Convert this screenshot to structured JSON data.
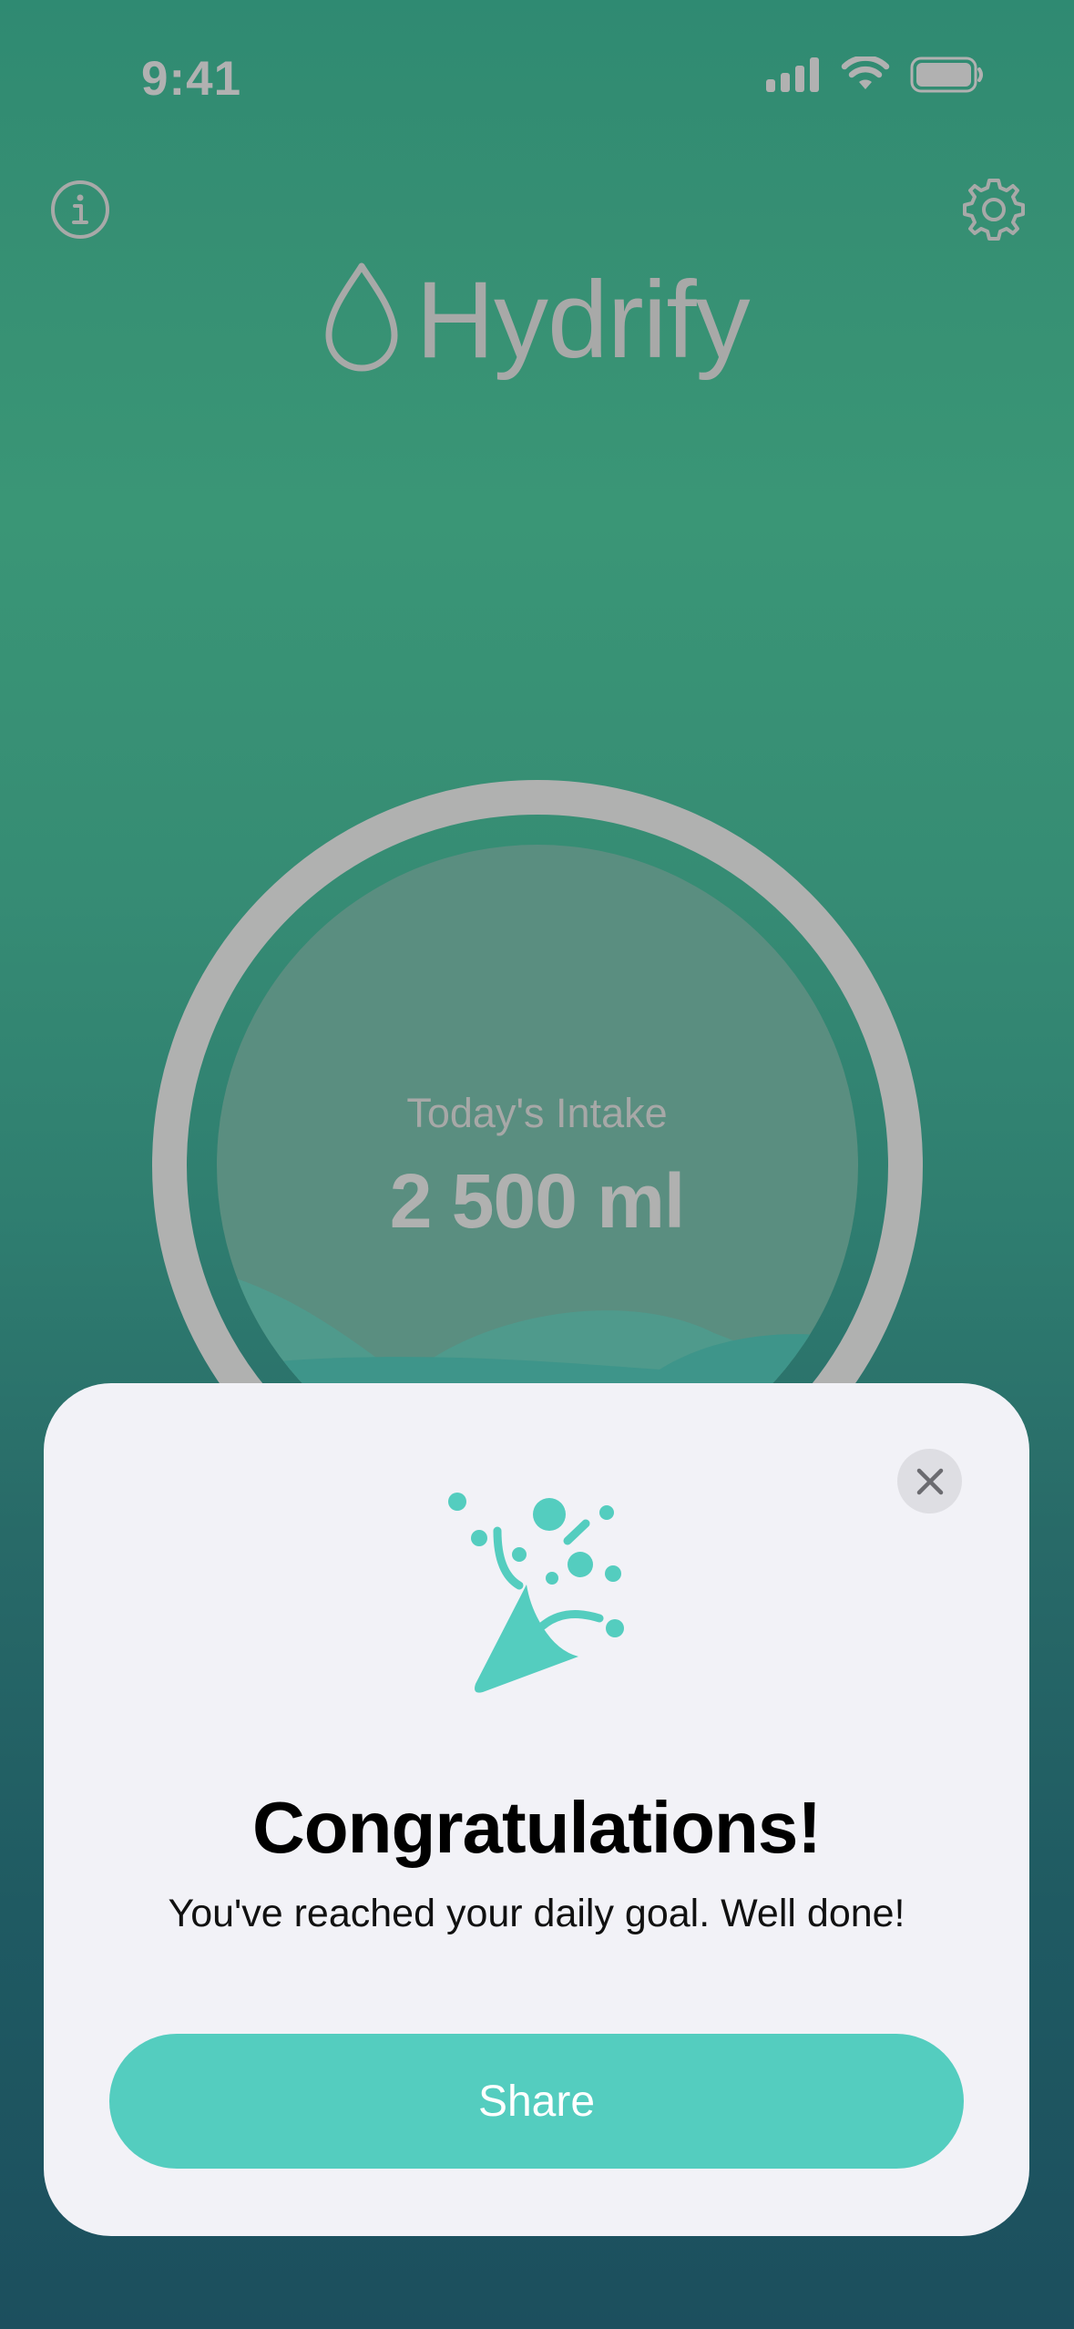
{
  "status_bar": {
    "time": "9:41",
    "icons": [
      "cellular-signal-icon",
      "wifi-icon",
      "battery-icon"
    ]
  },
  "header": {
    "info_icon": "info-icon",
    "settings_icon": "gear-icon",
    "app_name": "Hydrify",
    "logo_icon": "water-drop-icon"
  },
  "intake": {
    "label": "Today's Intake",
    "value": "2 500 ml"
  },
  "goal_sheet": {
    "close_icon": "close-icon",
    "illustration_icon": "party-popper-icon",
    "title": "Congratulations!",
    "message": "You've reached your daily goal. Well done!",
    "share_label": "Share"
  },
  "colors": {
    "accent": "#54cdbf",
    "sheet_background": "#f2f2f7",
    "muted_text": "#a8a9a8"
  }
}
